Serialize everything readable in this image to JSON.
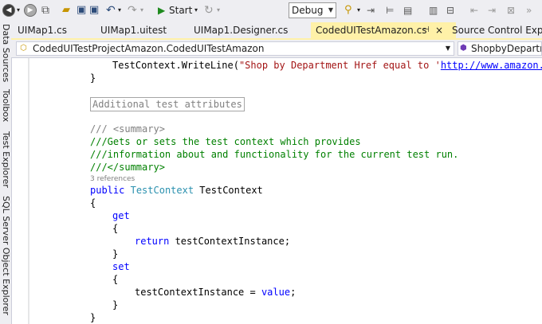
{
  "toolbar": {
    "start_label": "Start",
    "configuration": "Debug"
  },
  "side_panels": [
    "Data Sources",
    "Toolbox",
    "Test Explorer",
    "SQL Server Object Explorer"
  ],
  "tabs": [
    {
      "label": "UIMap1.cs"
    },
    {
      "label": "UIMap1.uitest"
    },
    {
      "label": "UIMap1.Designer.cs"
    },
    {
      "label": "CodedUITestAmazon.cs",
      "active": true
    },
    {
      "label": "Source Control Explor"
    }
  ],
  "tab_pin_glyph": "⊣",
  "tab_close_glyph": "×",
  "navbar": {
    "class_selector": "CodedUITestProjectAmazon.CodedUITestAmazon",
    "member_selector": "ShopbyDepartme"
  },
  "code": {
    "line1_prefix": "TestContext.WriteLine(",
    "line1_string": "\"Shop by Department Href equal to '",
    "line1_link": "http://www.amazon.co",
    "brace_close": "}",
    "brace_open": "{",
    "region_label": "Additional test attributes",
    "summary_open": "/// <summary>",
    "comment1": "///Gets or sets the test context which provides",
    "comment2": "///information about and functionality for the current test run.",
    "summary_close": "///</summary>",
    "references": "3 references",
    "kw_public": "public",
    "type_testcontext": "TestContext",
    "prop_name": " TestContext",
    "kw_get": "get",
    "kw_return": "return",
    "return_expr": " testContextInstance;",
    "kw_set": "set",
    "assign_prefix": "testContextInstance = ",
    "kw_value": "value",
    "assign_suffix": ";"
  },
  "colors": {
    "keyword": "#0000ff",
    "type": "#2b91af",
    "string": "#a31515",
    "comment": "#008000",
    "active_tab": "#fff1a8",
    "highlight": "#f5ef30"
  }
}
